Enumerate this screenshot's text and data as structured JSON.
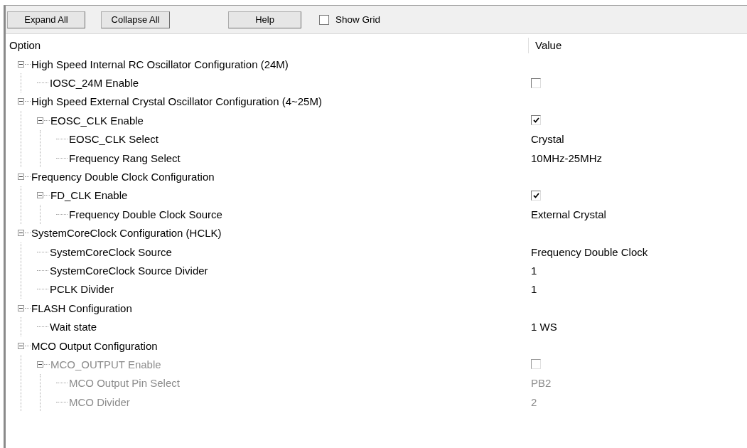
{
  "toolbar": {
    "buttons": [
      "Expand All",
      "Collapse All",
      "Help"
    ],
    "show_grid": {
      "label": "Show Grid",
      "checked": false
    }
  },
  "columns": [
    "Option",
    "Value"
  ],
  "tree": [
    {
      "label": "High Speed Internal RC Oscillator Configuration (24M)",
      "expanded": true,
      "disabled": false,
      "children": [
        {
          "label": "IOSC_24M Enable",
          "kind": "check",
          "checked": false,
          "disabled": false
        }
      ]
    },
    {
      "label": "High Speed External Crystal Oscillator Configuration (4~25M)",
      "expanded": true,
      "disabled": false,
      "children": [
        {
          "label": "EOSC_CLK Enable",
          "kind": "check",
          "checked": true,
          "expanded": true,
          "disabled": false,
          "children": [
            {
              "label": "EOSC_CLK Select",
              "kind": "text",
              "value": "Crystal",
              "disabled": false
            },
            {
              "label": "Frequency Rang Select",
              "kind": "text",
              "value": "10MHz-25MHz",
              "disabled": false
            }
          ]
        }
      ]
    },
    {
      "label": "Frequency Double Clock Configuration",
      "expanded": true,
      "disabled": false,
      "children": [
        {
          "label": "FD_CLK Enable",
          "kind": "check",
          "checked": true,
          "expanded": true,
          "disabled": false,
          "children": [
            {
              "label": "Frequency Double Clock Source",
              "kind": "text",
              "value": "External Crystal",
              "disabled": false
            }
          ]
        }
      ]
    },
    {
      "label": "SystemCoreClock Configuration (HCLK)",
      "expanded": true,
      "disabled": false,
      "children": [
        {
          "label": "SystemCoreClock Source",
          "kind": "text",
          "value": "Frequency Double Clock",
          "disabled": false
        },
        {
          "label": "SystemCoreClock Source Divider",
          "kind": "text",
          "value": "1",
          "disabled": false
        },
        {
          "label": "PCLK Divider",
          "kind": "text",
          "value": "1",
          "disabled": false
        }
      ]
    },
    {
      "label": "FLASH Configuration",
      "expanded": true,
      "disabled": false,
      "children": [
        {
          "label": "Wait state",
          "kind": "text",
          "value": "1 WS",
          "disabled": false
        }
      ]
    },
    {
      "label": "MCO Output Configuration",
      "expanded": true,
      "disabled": false,
      "children": [
        {
          "label": "MCO_OUTPUT Enable",
          "kind": "check",
          "checked": false,
          "expanded": true,
          "disabled": true,
          "children": [
            {
              "label": "MCO Output Pin Select",
              "kind": "text",
              "value": "PB2",
              "disabled": true
            },
            {
              "label": "MCO Divider",
              "kind": "text",
              "value": "2",
              "disabled": true
            }
          ]
        }
      ]
    }
  ]
}
